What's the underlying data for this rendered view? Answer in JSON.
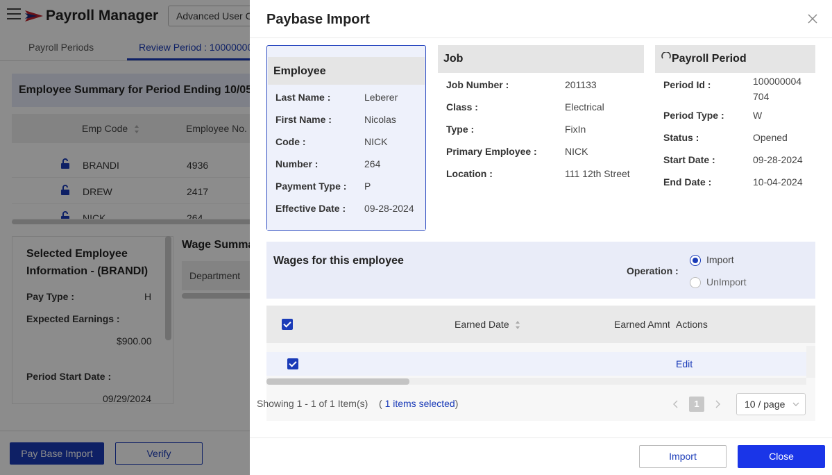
{
  "app": {
    "title": "Payroll Manager",
    "advanced_button": "Advanced User C",
    "tabs": [
      {
        "label": "Payroll Periods"
      },
      {
        "label": "Review Period : 10000000"
      }
    ],
    "summary_title": "Employee Summary for Period Ending 10/05",
    "employee_table": {
      "headers": [
        "Emp Code",
        "Employee No."
      ],
      "rows": [
        {
          "code": "BRANDI",
          "number": "4936"
        },
        {
          "code": "DREW",
          "number": "2417"
        },
        {
          "code": "NICK",
          "number": "264"
        }
      ]
    },
    "selected_employee": {
      "title": "Selected Employee Information - (BRANDI)",
      "pay_type_label": "Pay Type :",
      "pay_type_value": "H",
      "expected_earnings_label": "Expected Earnings :",
      "expected_earnings_value": "$900.00",
      "period_start_label": "Period Start Date :",
      "period_start_value": "09/29/2024"
    },
    "wage_summary": {
      "title": "Wage Summa",
      "department_header": "Department"
    },
    "bottom": {
      "paybase_import": "Pay Base Import",
      "verify": "Verify"
    }
  },
  "drawer": {
    "title": "Paybase Import",
    "employee": {
      "title": "Employee",
      "fields": [
        {
          "label": "Last Name :",
          "value": "Leberer"
        },
        {
          "label": "First Name :",
          "value": "Nicolas"
        },
        {
          "label": "Code :",
          "value": "NICK"
        },
        {
          "label": "Number :",
          "value": "264"
        },
        {
          "label": "Payment Type :",
          "value": "P"
        },
        {
          "label": "Effective Date :",
          "value": "09-28-2024"
        }
      ]
    },
    "job": {
      "title": "Job",
      "fields": [
        {
          "label": "Job Number :",
          "value": "201133"
        },
        {
          "label": "Class :",
          "value": "Electrical"
        },
        {
          "label": "Type :",
          "value": "FixIn"
        },
        {
          "label": "Primary Employee :",
          "value": "NICK"
        },
        {
          "label": "Location :",
          "value": "111 12th Street"
        }
      ]
    },
    "payroll_period": {
      "title": "Payroll Period",
      "fields": [
        {
          "label": "Period Id :",
          "value_line1": "100000004",
          "value_line2": "704"
        },
        {
          "label": "Period Type :",
          "value": "W"
        },
        {
          "label": "Status :",
          "value": "Opened"
        },
        {
          "label": "Start Date :",
          "value": "09-28-2024"
        },
        {
          "label": "End Date :",
          "value": "10-04-2024"
        }
      ]
    },
    "wages": {
      "title": "Wages for this employee",
      "operation_label": "Operation :",
      "options": [
        {
          "label": "Import",
          "selected": true
        },
        {
          "label": "UnImport",
          "selected": false
        }
      ]
    },
    "grid": {
      "headers": [
        "Earned Date",
        "Earned Amnt",
        "Actions"
      ],
      "rows": [
        {
          "action": "Edit"
        }
      ]
    },
    "pagination": {
      "showing": "Showing 1 - 1 of 1 Item(s)",
      "selected_prefix": "( ",
      "selected_text": "1 items selected",
      "selected_suffix": ")",
      "current_page": "1",
      "page_size": "10 / page"
    },
    "footer": {
      "import": "Import",
      "close": "Close"
    }
  },
  "colors": {
    "primary": "#1a3bb8",
    "close_button": "#1a35e8",
    "card_border": "#2a49c0",
    "panel_bg": "#e9ecf8"
  }
}
